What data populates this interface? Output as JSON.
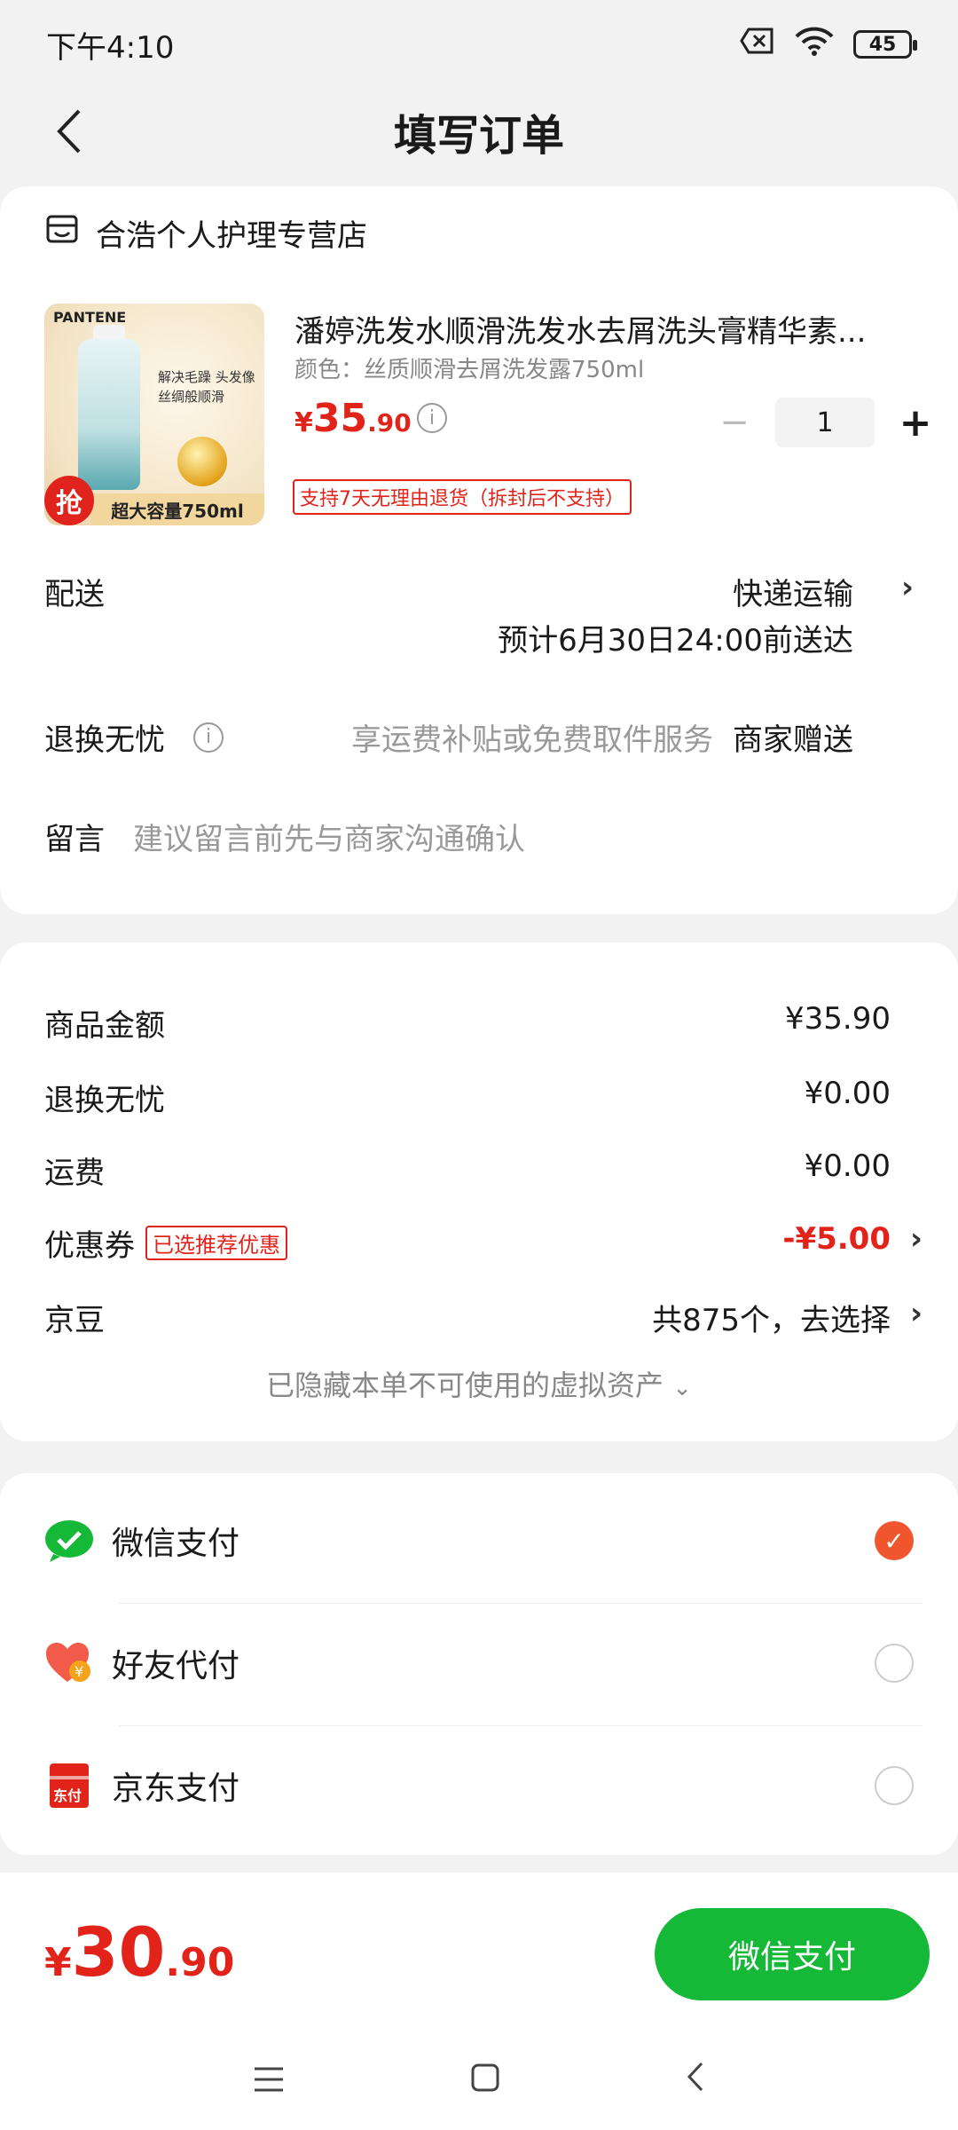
{
  "status_bar": {
    "time": "下午4:10",
    "battery": "45"
  },
  "nav": {
    "title": "填写订单"
  },
  "shop": {
    "name": "合浩个人护理专营店"
  },
  "product": {
    "image_brand": "PANTENE",
    "image_text": "解决毛躁 头发像丝绸般顺滑",
    "image_badge": "抢",
    "image_caption": "超大容量750ml",
    "name": "潘婷洗发水顺滑洗发水去屑洗头膏精华素...",
    "spec": "颜色：丝质顺滑去屑洗发露750ml",
    "price_symbol": "¥",
    "price_int": "35",
    "price_dec": ".90",
    "quantity": "1",
    "return_tag": "支持7天无理由退货（拆封后不支持）"
  },
  "delivery": {
    "label": "配送",
    "method": "快递运输",
    "eta": "预计6月30日24:00前送达"
  },
  "return_worry": {
    "label": "退换无忧",
    "desc": "享运费补贴或免费取件服务",
    "value": "商家赠送"
  },
  "message": {
    "label": "留言",
    "placeholder": "建议留言前先与商家沟通确认"
  },
  "summary": {
    "rows": [
      {
        "label": "商品金额",
        "value": "¥35.90"
      },
      {
        "label": "退换无忧",
        "value": "¥0.00"
      },
      {
        "label": "运费",
        "value": "¥0.00"
      },
      {
        "label": "优惠券",
        "tag": "已选推荐优惠",
        "value": "-¥5.00"
      },
      {
        "label": "京豆",
        "value": "共875个，去选择"
      }
    ],
    "hidden_assets": "已隐藏本单不可使用的虚拟资产"
  },
  "payments": [
    {
      "label": "微信支付",
      "selected": true
    },
    {
      "label": "好友代付",
      "selected": false
    },
    {
      "label": "京东支付",
      "selected": false
    }
  ],
  "bottom": {
    "symbol": "¥",
    "total_int": "30",
    "total_dec": ".90",
    "pay_button": "微信支付"
  },
  "colors": {
    "accent_red": "#e2231a",
    "wechat_green": "#16b838",
    "radio_selected": "#f0562d"
  }
}
